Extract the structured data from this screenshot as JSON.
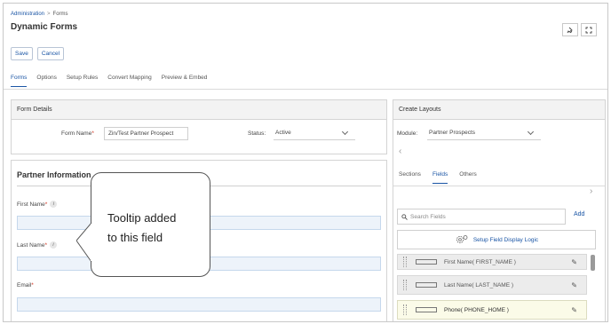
{
  "breadcrumb": {
    "root": "Administration",
    "separator": ">",
    "current": "Forms"
  },
  "page_title": "Dynamic Forms",
  "header_icons": [
    "pin-icon",
    "expand-icon"
  ],
  "actions": {
    "save": "Save",
    "cancel": "Cancel"
  },
  "tabs": [
    "Forms",
    "Options",
    "Setup Rules",
    "Convert Mapping",
    "Preview & Embed"
  ],
  "active_tab": "Forms",
  "form_details": {
    "heading": "Form Details",
    "form_name_label": "Form Name",
    "form_name_required": "*",
    "form_name_value": "Zin/Test Partner Prospect",
    "status_label": "Status",
    "status_value": "Active"
  },
  "partner_info": {
    "heading": "Partner Information",
    "fields": [
      {
        "label": "First Name",
        "required": "*",
        "info": "i"
      },
      {
        "label": "Last Name",
        "required": "*",
        "info": "i"
      },
      {
        "label": "Email",
        "required": "*",
        "info": ""
      }
    ]
  },
  "tooltip": {
    "line1": "Tooltip added",
    "line2": "to this field"
  },
  "create_layouts": {
    "heading": "Create Layouts",
    "module_label": "Module:",
    "module_value": "Partner Prospects",
    "tabs": [
      "Sections",
      "Fields",
      "Others"
    ],
    "active_tab": "Fields",
    "search_placeholder": "Search Fields",
    "add_label": "Add",
    "logic_label": "Setup Field Display Logic",
    "field_items": [
      {
        "label": "First Name( FIRST_NAME )",
        "highlighted": false
      },
      {
        "label": "Last Name( LAST_NAME )",
        "highlighted": false
      },
      {
        "label": "Phone( PHONE_HOME )",
        "highlighted": true
      }
    ]
  },
  "colors": {
    "accent": "#1a55a5",
    "required": "#d0301c",
    "input_fill": "#edf3fa",
    "highlight": "#fbfbe8"
  }
}
